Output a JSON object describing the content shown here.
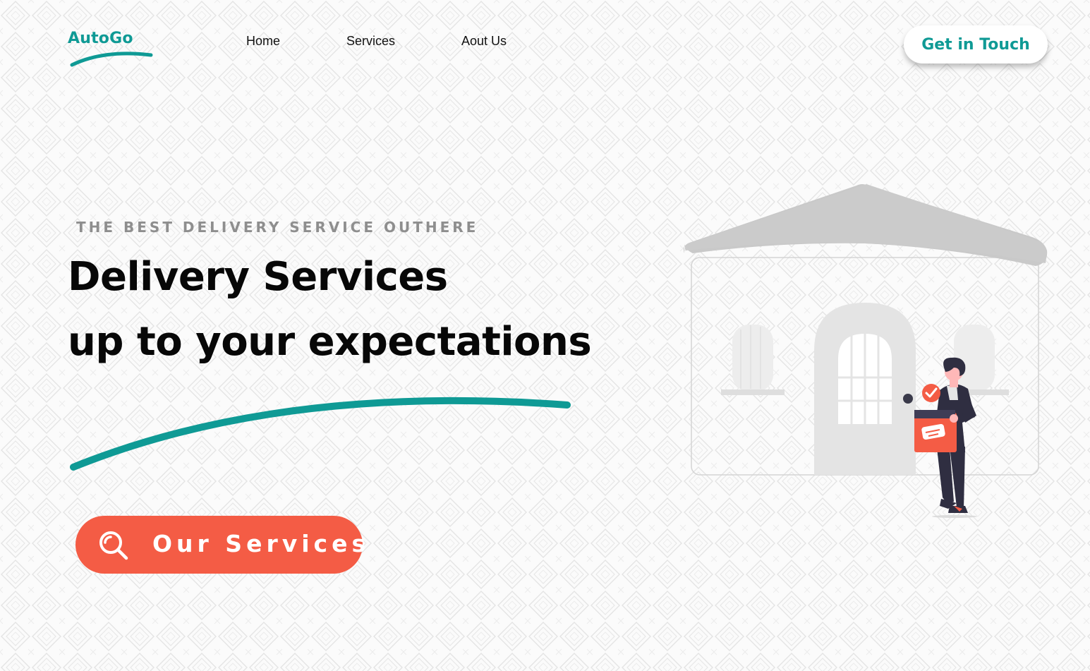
{
  "colors": {
    "brand": "#0f9a95",
    "accent": "#f45c45",
    "background": "#fbfbfb",
    "pattern": "#e6e6e6"
  },
  "header": {
    "logo": "AutoGo",
    "nav": [
      {
        "label": "Home"
      },
      {
        "label": "Services"
      },
      {
        "label": "Aout Us"
      }
    ],
    "cta_label": "Get in Touch"
  },
  "hero": {
    "eyebrow": "THE BEST DELIVERY SERVICE OUTHERE",
    "title_line1": "Delivery Services",
    "title_line2": "up to your expectations",
    "cta_label": "Our Services",
    "cta_icon": "search-icon"
  },
  "illustration": {
    "icons": [
      "house-icon",
      "delivery-person-icon",
      "package-icon",
      "check-icon"
    ]
  }
}
